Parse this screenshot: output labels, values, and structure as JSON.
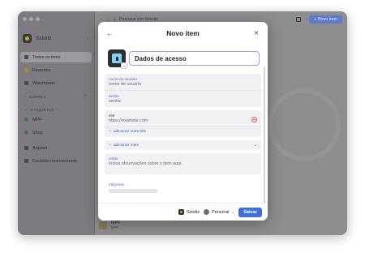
{
  "app": {
    "vault_name": "Sztoltz",
    "search_placeholder": "Procurar em Sztoltz",
    "new_item_label": "+ Novo item"
  },
  "sidebar": {
    "items": [
      {
        "label": "Todos os itens",
        "active": true
      },
      {
        "label": "Favoritos"
      },
      {
        "label": "Watchtower"
      }
    ],
    "sections": {
      "cofres": "COFRES",
      "etiquetas": "ETIQUETAS"
    },
    "tags": [
      {
        "label": "MPF"
      },
      {
        "label": "Shop"
      }
    ],
    "bottom_items": [
      {
        "label": "Arquivo"
      },
      {
        "label": "Excluído recentemente"
      }
    ]
  },
  "list": {
    "item_title": "MPF",
    "item_sub": "MPF"
  },
  "modal": {
    "title": "Novo item",
    "item_title": "Dados de acesso",
    "fields": [
      {
        "label": "nome do usuário",
        "value": "nome de usuário"
      },
      {
        "label": "senha",
        "value": "senha"
      }
    ],
    "website": {
      "label": "site",
      "value": "https://example.com"
    },
    "add_website": "adicionar outro site",
    "add_more": "adicionar mais",
    "notes": {
      "label": "notas",
      "value": "Inclua observações sobre o item aqui."
    },
    "tags_label": "etiquetas",
    "footer": {
      "vault": "Sztoltz",
      "account": "Personal",
      "save": "Salvar"
    }
  }
}
